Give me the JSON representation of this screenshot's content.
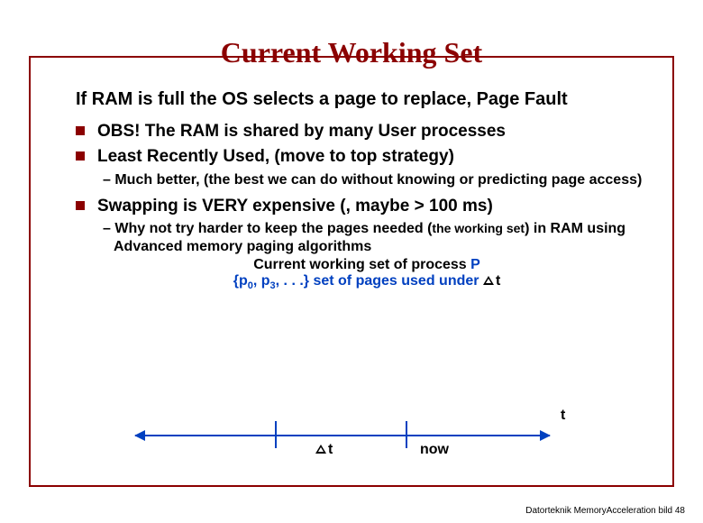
{
  "title": "Current Working Set",
  "intro": "If RAM is full the OS selects a page to replace, Page Fault",
  "b1": "OBS! The RAM is shared by many User processes",
  "b2": "Least Recently Used, (move to top strategy)",
  "b2s": "– Much better, (the best we can do without knowing or predicting page access)",
  "b3": "Swapping is VERY expensive (, maybe > 100 ms)",
  "b3s_prefix": "– Why not try harder to keep the pages needed (",
  "b3s_span": "the working set",
  "b3s_suffix": ") in RAM using Advanced memory paging algorithms",
  "cws_line_pre": "Current working set of process ",
  "cws_P": "P",
  "set_def_pre": "{p",
  "set_def_mid1": "0",
  "set_def_mid2": ", p",
  "set_def_mid3": "3",
  "set_def_suffix": ", . . .} set of pages used under ",
  "deltaT1": "t",
  "axis_right_t": "t",
  "label_deltaT": "t",
  "label_now": "now",
  "footer": "Datorteknik MemoryAcceleration bild 48"
}
